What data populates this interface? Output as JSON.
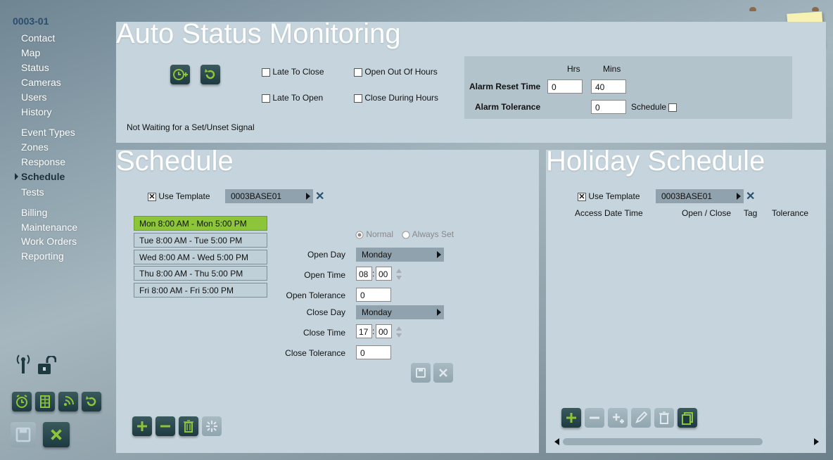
{
  "account_code": "0003-01",
  "nav": {
    "group1": [
      "Contact",
      "Map",
      "Status",
      "Cameras",
      "Users",
      "History"
    ],
    "group2": [
      "Event Types",
      "Zones",
      "Response",
      "Schedule",
      "Tests"
    ],
    "group3": [
      "Billing",
      "Maintenance",
      "Work Orders",
      "Reporting"
    ],
    "active": "Schedule"
  },
  "auto_status": {
    "title": "Auto Status Monitoring",
    "late_to_close": "Late To Close",
    "late_to_open": "Late To Open",
    "open_out_of_hours": "Open Out Of Hours",
    "close_during_hours": "Close During Hours",
    "status_text": "Not Waiting for a Set/Unset Signal",
    "hrs_label": "Hrs",
    "mins_label": "Mins",
    "alarm_reset_label": "Alarm Reset Time",
    "alarm_reset_hrs": "0",
    "alarm_reset_mins": "40",
    "alarm_tolerance_label": "Alarm Tolerance",
    "alarm_tolerance_value": "0",
    "schedule_label": "Schedule"
  },
  "schedule": {
    "title": "Schedule",
    "use_template_label": "Use Template",
    "template_value": "0003BASE01",
    "items": [
      "Mon 8:00 AM - Mon 5:00 PM",
      "Tue 8:00 AM - Tue 5:00 PM",
      "Wed 8:00 AM - Wed 5:00 PM",
      "Thu 8:00 AM - Thu 5:00 PM",
      "Fri 8:00 AM - Fri 5:00 PM"
    ],
    "normal_label": "Normal",
    "always_set_label": "Always Set",
    "open_day_label": "Open Day",
    "open_day_value": "Monday",
    "open_time_label": "Open Time",
    "open_time_h": "08",
    "open_time_m": "00",
    "open_tolerance_label": "Open Tolerance",
    "open_tolerance_value": "0",
    "close_day_label": "Close Day",
    "close_day_value": "Monday",
    "close_time_label": "Close Time",
    "close_time_h": "17",
    "close_time_m": "00",
    "close_tolerance_label": "Close Tolerance",
    "close_tolerance_value": "0",
    "time_separator": ":"
  },
  "holiday": {
    "title": "Holiday Schedule",
    "use_template_label": "Use Template",
    "template_value": "0003BASE01",
    "col_access": "Access Date Time",
    "col_open_close": "Open / Close",
    "col_tag": "Tag",
    "col_tolerance": "Tolerance"
  },
  "colors": {
    "accent_green": "#8cc43a",
    "panel": "#c6d5dd",
    "dark_button": "#1d3a40"
  }
}
